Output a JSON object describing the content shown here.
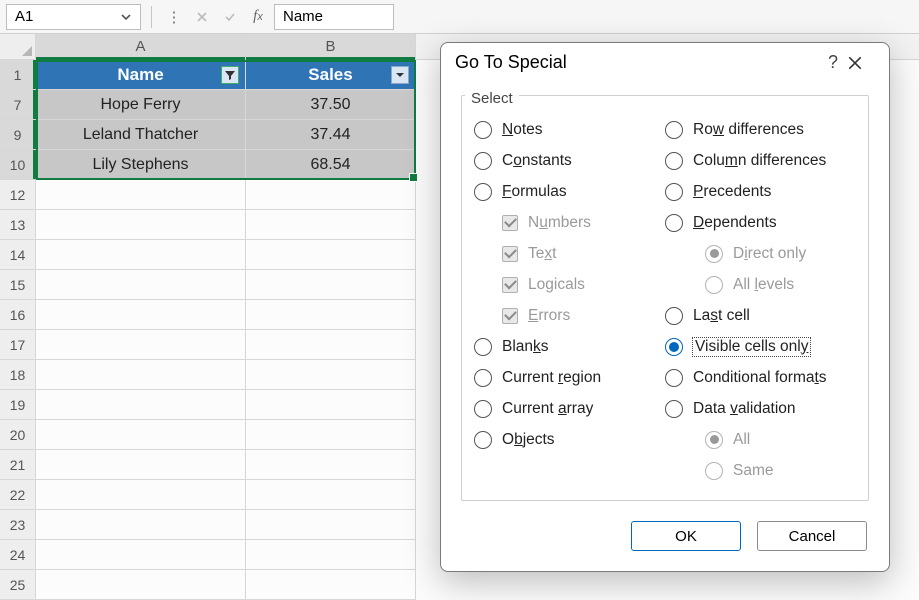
{
  "formula_bar": {
    "cell_ref": "A1",
    "formula_value": "Name"
  },
  "columns": {
    "A": "A",
    "B": "B"
  },
  "row_headers": [
    "1",
    "7",
    "9",
    "10",
    "12",
    "13",
    "14",
    "15",
    "16",
    "17",
    "18",
    "19",
    "20",
    "21",
    "22",
    "23",
    "24",
    "25"
  ],
  "table": {
    "headers": {
      "name": "Name",
      "sales": "Sales"
    },
    "rows": [
      {
        "name": "Hope Ferry",
        "sales": "37.50"
      },
      {
        "name": "Leland Thatcher",
        "sales": "37.44"
      },
      {
        "name": "Lily Stephens",
        "sales": "68.54"
      }
    ]
  },
  "dialog": {
    "title": "Go To Special",
    "group_label": "Select",
    "left": {
      "notes": "Notes",
      "constants": "Constants",
      "formulas": "Formulas",
      "numbers": "Numbers",
      "text": "Text",
      "logicals": "Logicals",
      "errors": "Errors",
      "blanks": "Blanks",
      "current_region": "Current region",
      "current_array": "Current array",
      "objects": "Objects"
    },
    "right": {
      "row_diff": "Row differences",
      "col_diff": "Column differences",
      "precedents": "Precedents",
      "dependents": "Dependents",
      "direct": "Direct only",
      "all_levels": "All levels",
      "last_cell": "Last cell",
      "visible": "Visible cells only",
      "cond_fmt": "Conditional formats",
      "data_val": "Data validation",
      "all": "All",
      "same": "Same"
    },
    "buttons": {
      "ok": "OK",
      "cancel": "Cancel"
    }
  }
}
